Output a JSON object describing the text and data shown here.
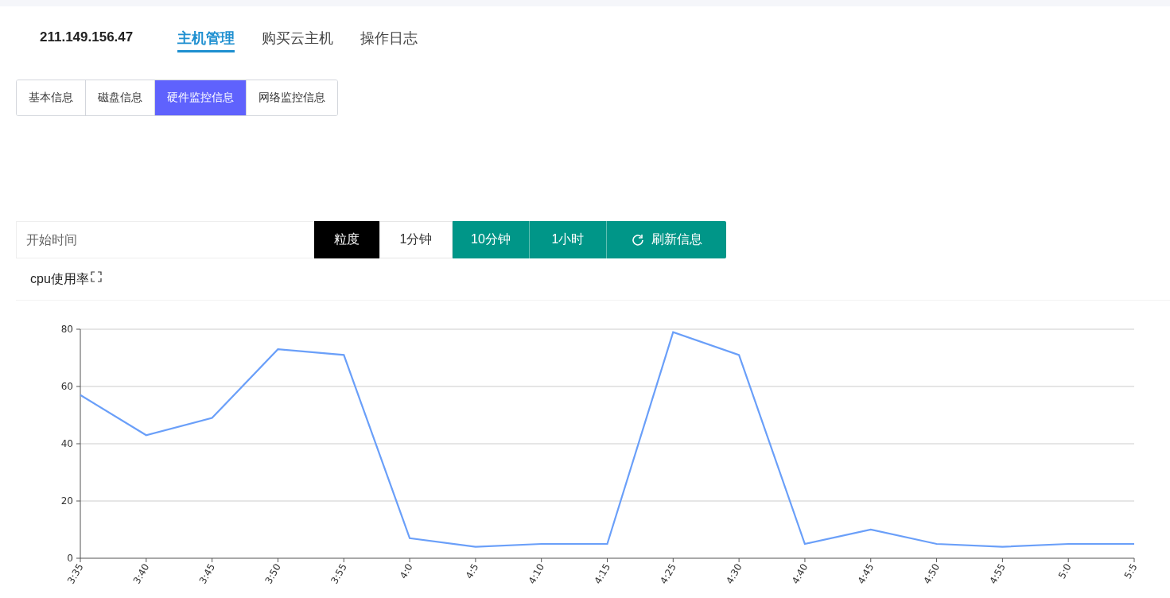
{
  "host": {
    "ip": "211.149.156.47"
  },
  "nav": [
    {
      "label": "主机管理",
      "selected": true
    },
    {
      "label": "购买云主机",
      "selected": false
    },
    {
      "label": "操作日志",
      "selected": false
    }
  ],
  "tabs": [
    {
      "label": "基本信息",
      "selected": false
    },
    {
      "label": "磁盘信息",
      "selected": false
    },
    {
      "label": "硬件监控信息",
      "selected": true
    },
    {
      "label": "网络监控信息",
      "selected": false
    }
  ],
  "toolbar": {
    "start_time": {
      "placeholder": "开始时间"
    },
    "granularity": [
      {
        "kind": "label",
        "label": "粒度"
      },
      {
        "kind": "plain",
        "label": "1分钟"
      },
      {
        "kind": "primary",
        "label": "10分钟"
      },
      {
        "kind": "primary",
        "label": "1小时"
      }
    ],
    "refresh_button": "刷新信息"
  },
  "panel": {
    "title": "cpu使用率",
    "chart_data": {
      "type": "line",
      "categories": [
        "3:35",
        "3:40",
        "3:45",
        "3:50",
        "3:55",
        "4:0",
        "4:5",
        "4:10",
        "4:15",
        "4:25",
        "4:30",
        "4:40",
        "4:45",
        "4:50",
        "4:55",
        "5:0",
        "5:5"
      ],
      "grid": true,
      "series": [
        {
          "color": "#6a9ff9",
          "values": [
            57,
            43,
            49,
            73,
            71,
            7,
            4,
            5,
            5,
            79,
            71,
            5,
            10,
            5,
            4,
            5,
            5
          ]
        }
      ],
      "ylim": [
        0,
        80
      ],
      "yticks": [
        0,
        20,
        40,
        60,
        80
      ]
    }
  }
}
